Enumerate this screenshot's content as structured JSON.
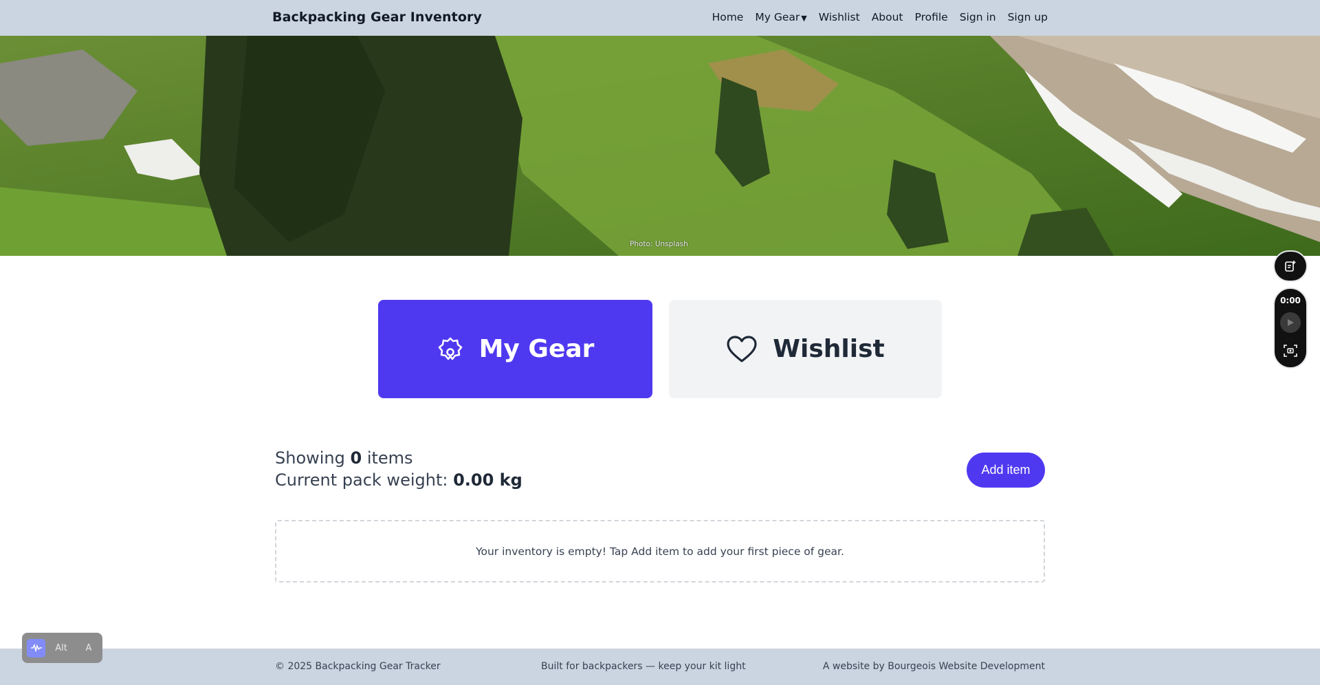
{
  "header": {
    "brand": "Backpacking Gear Inventory",
    "nav": {
      "home": "Home",
      "my_gear": "My Gear",
      "wishlist": "Wishlist",
      "about": "About",
      "profile": "Profile",
      "sign_in": "Sign in",
      "sign_up": "Sign up"
    }
  },
  "hero": {
    "photo_credit": "Photo: Unsplash"
  },
  "tabs": {
    "my_gear": {
      "label": "My Gear",
      "icon": "gear-cog-icon",
      "active": true
    },
    "wishlist": {
      "label": "Wishlist",
      "icon": "heart-icon",
      "active": false
    }
  },
  "summary": {
    "showing_prefix": "Showing ",
    "count": "0",
    "showing_suffix": " items",
    "weight_prefix": "Current pack weight: ",
    "weight": "0.00 kg"
  },
  "add_button": "Add item",
  "empty_message": "Your inventory is empty! Tap Add item to add your first piece of gear.",
  "footer": {
    "left": "© 2025 Backpacking Gear Tracker",
    "middle": "Built for backpackers — keep your kit light",
    "right": "A website by Bourgeois Website Development"
  },
  "recorder": {
    "time": "0:00"
  },
  "keyboard_widget": {
    "key1": "Alt",
    "key2": "A"
  },
  "colors": {
    "accent": "#4f39f0",
    "header_bg": "#cbd5e1",
    "card_bg": "#f1f3f5"
  }
}
